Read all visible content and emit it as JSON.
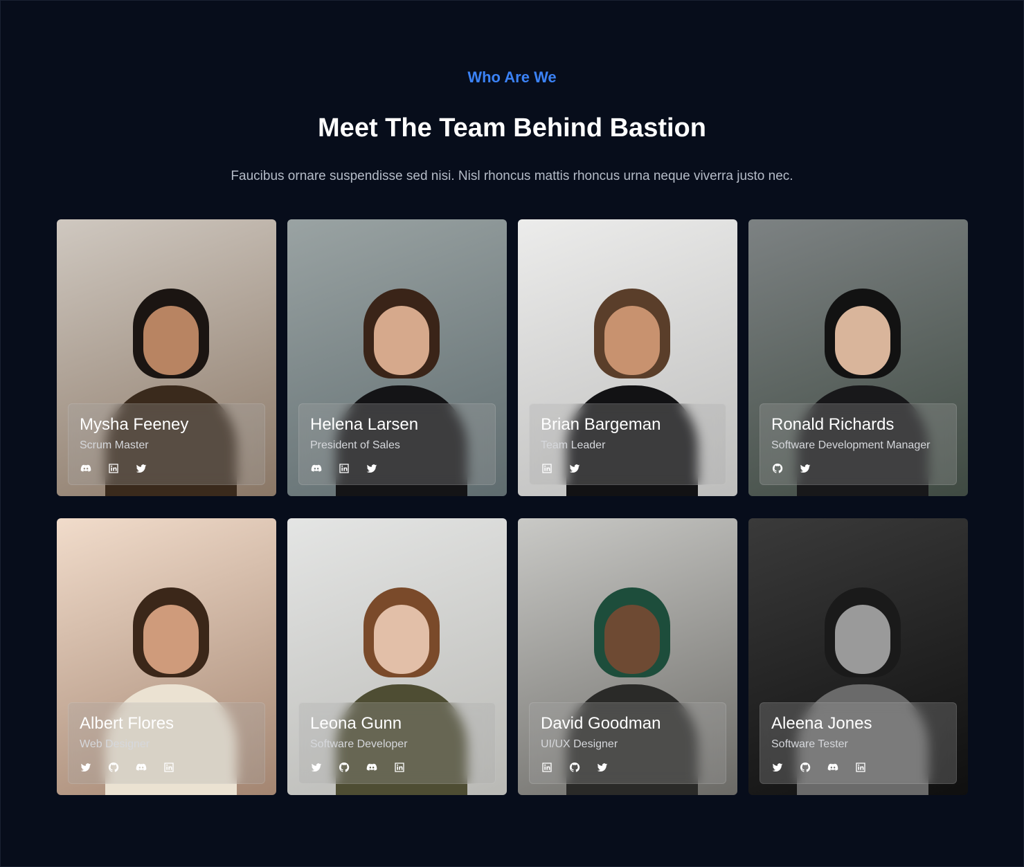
{
  "header": {
    "eyebrow": "Who Are We",
    "title": "Meet The Team Behind Bastion",
    "subtitle": "Faucibus ornare suspendisse sed nisi. Nisl rhoncus mattis rhoncus urna neque viverra justo nec."
  },
  "team": [
    {
      "name": "Mysha Feeney",
      "role": "Scrum Master",
      "socials": [
        "discord-icon",
        "linkedin-icon",
        "twitter-icon"
      ],
      "bg": "#cfc8c0",
      "bg2": "#8a7766",
      "skin": "#b88462",
      "hair": "#1b1512",
      "clothes": "#3a2a1c"
    },
    {
      "name": "Helena Larsen",
      "role": "President of Sales",
      "socials": [
        "discord-icon",
        "linkedin-icon",
        "twitter-icon"
      ],
      "bg": "#9aa3a3",
      "bg2": "#5f6c6f",
      "skin": "#d6a98c",
      "hair": "#3a2418",
      "clothes": "#141416"
    },
    {
      "name": "Brian Bargeman",
      "role": "Team Leader",
      "socials": [
        "linkedin-icon",
        "twitter-icon"
      ],
      "bg": "#ececeb",
      "bg2": "#bdbdbc",
      "skin": "#c8926f",
      "hair": "#5a3e2a",
      "clothes": "#121214"
    },
    {
      "name": "Ronald Richards",
      "role": "Software Development Manager",
      "socials": [
        "github-icon",
        "twitter-icon"
      ],
      "bg": "#7d8283",
      "bg2": "#3f4a42",
      "skin": "#d9b59b",
      "hair": "#121212",
      "clothes": "#18181a"
    },
    {
      "name": "Albert Flores",
      "role": "Web Designer",
      "socials": [
        "twitter-icon",
        "github-icon",
        "discord-icon",
        "linkedin-icon"
      ],
      "bg": "#f1dccb",
      "bg2": "#a38571",
      "skin": "#cf9b7b",
      "hair": "#3b2719",
      "clothes": "#ebe2d2"
    },
    {
      "name": "Leona Gunn",
      "role": "Software Developer",
      "socials": [
        "twitter-icon",
        "github-icon",
        "discord-icon",
        "linkedin-icon"
      ],
      "bg": "#e4e5e4",
      "bg2": "#b9b9b5",
      "skin": "#e2bfa8",
      "hair": "#7a4a2a",
      "clothes": "#4e4d33"
    },
    {
      "name": "David Goodman",
      "role": "UI/UX Designer",
      "socials": [
        "linkedin-icon",
        "github-icon",
        "twitter-icon"
      ],
      "bg": "#c9c9c6",
      "bg2": "#6b6a66",
      "skin": "#6e4a33",
      "hair": "#1d4d3b",
      "clothes": "#2a2a28"
    },
    {
      "name": "Aleena Jones",
      "role": "Software Tester",
      "socials": [
        "twitter-icon",
        "github-icon",
        "discord-icon",
        "linkedin-icon"
      ],
      "bg": "#3a3a3a",
      "bg2": "#0f0f0f",
      "skin": "#9a9a9a",
      "hair": "#1a1a1a",
      "clothes": "#6a6a6a"
    }
  ]
}
